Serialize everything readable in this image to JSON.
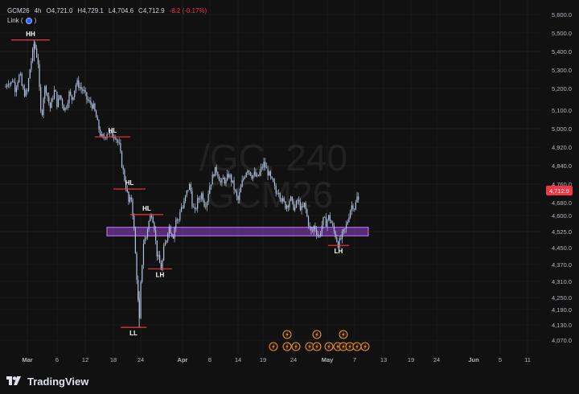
{
  "legend": {
    "symbol": "GCM26",
    "interval": "4h",
    "open_label": "O",
    "open": "4,721.0",
    "high_label": "H",
    "high": "4,729.1",
    "low_label": "L",
    "low": "4,704.6",
    "close_label": "C",
    "close": "4,712.9",
    "change": "-8.2 (-0.17%)",
    "link_label": "Link ("
  },
  "watermark": {
    "line1": "/GC, 240",
    "line2": "GCM26"
  },
  "price_badge": "4,712.9",
  "brand": "TradingView",
  "colors": {
    "background": "#111111",
    "candle": "#b2c3e0",
    "level_line": "#f23645",
    "zone_fill": "#8e44c9",
    "zone_border": "#c77dff",
    "price_badge": "#f23645",
    "axis_text": "#b2b5be",
    "event_icon": "#f08a24"
  },
  "chart_data": {
    "type": "candlestick",
    "symbol": "GCM26",
    "interval": "4h",
    "y_ticks": [
      "5,600.0",
      "5,500.0",
      "5,400.0",
      "5,300.0",
      "5,200.0",
      "5,100.0",
      "5,000.0",
      "4,920.0",
      "4,840.0",
      "4,760.0",
      "4,680.0",
      "4,600.0",
      "4,525.0",
      "4,450.0",
      "4,370.0",
      "4,310.0",
      "4,250.0",
      "4,190.0",
      "4,130.0",
      "4,070.0"
    ],
    "x_ticks": [
      "Mar",
      "6",
      "12",
      "18",
      "24",
      "Apr",
      "8",
      "14",
      "19",
      "24",
      "May",
      "7",
      "13",
      "19",
      "24",
      "Jun",
      "5",
      "11"
    ],
    "ylim": [
      4040,
      5620
    ],
    "last_price": 4712.9,
    "swing_labels": [
      {
        "text": "HH",
        "price": 5480
      },
      {
        "text": "HL",
        "price": 5025
      },
      {
        "text": "HL",
        "price": 4780
      },
      {
        "text": "HL",
        "price": 4660
      },
      {
        "text": "LH",
        "price": 4405
      },
      {
        "text": "LL",
        "price": 4130
      },
      {
        "text": "LH",
        "price": 4515
      }
    ],
    "zone": {
      "from": 4560,
      "to": 4600
    },
    "close_path": [
      [
        0,
        5260
      ],
      [
        3,
        5290
      ],
      [
        6,
        5270
      ],
      [
        9,
        5300
      ],
      [
        12,
        5250
      ],
      [
        15,
        5290
      ],
      [
        18,
        5320
      ],
      [
        21,
        5250
      ],
      [
        24,
        5230
      ],
      [
        27,
        5230
      ],
      [
        30,
        5330
      ],
      [
        33,
        5400
      ],
      [
        36,
        5470
      ],
      [
        38,
        5430
      ],
      [
        41,
        5370
      ],
      [
        43,
        5200
      ],
      [
        45,
        5100
      ],
      [
        47,
        5200
      ],
      [
        50,
        5270
      ],
      [
        53,
        5210
      ],
      [
        56,
        5160
      ],
      [
        59,
        5210
      ],
      [
        62,
        5250
      ],
      [
        65,
        5170
      ],
      [
        68,
        5220
      ],
      [
        71,
        5190
      ],
      [
        74,
        5150
      ],
      [
        77,
        5180
      ],
      [
        80,
        5230
      ],
      [
        83,
        5200
      ],
      [
        86,
        5240
      ],
      [
        89,
        5280
      ],
      [
        92,
        5270
      ],
      [
        95,
        5250
      ],
      [
        98,
        5240
      ],
      [
        101,
        5210
      ],
      [
        104,
        5190
      ],
      [
        107,
        5180
      ],
      [
        110,
        5170
      ],
      [
        113,
        5130
      ],
      [
        116,
        5080
      ],
      [
        119,
        5040
      ],
      [
        122,
        5010
      ],
      [
        125,
        5030
      ],
      [
        128,
        5050
      ],
      [
        131,
        5040
      ],
      [
        134,
        5030
      ],
      [
        137,
        5040
      ],
      [
        140,
        5010
      ],
      [
        143,
        4980
      ],
      [
        146,
        4900
      ],
      [
        149,
        4840
      ],
      [
        152,
        4780
      ],
      [
        155,
        4710
      ],
      [
        158,
        4740
      ],
      [
        161,
        4620
      ],
      [
        164,
        4420
      ],
      [
        166,
        4300
      ],
      [
        168,
        4130
      ],
      [
        170,
        4330
      ],
      [
        172,
        4450
      ],
      [
        174,
        4560
      ],
      [
        176,
        4530
      ],
      [
        178,
        4590
      ],
      [
        181,
        4640
      ],
      [
        184,
        4670
      ],
      [
        187,
        4600
      ],
      [
        190,
        4480
      ],
      [
        193,
        4440
      ],
      [
        196,
        4400
      ],
      [
        199,
        4500
      ],
      [
        202,
        4540
      ],
      [
        205,
        4610
      ],
      [
        208,
        4580
      ],
      [
        211,
        4560
      ],
      [
        214,
        4640
      ],
      [
        217,
        4620
      ],
      [
        220,
        4700
      ],
      [
        223,
        4690
      ],
      [
        226,
        4740
      ],
      [
        229,
        4780
      ],
      [
        232,
        4800
      ],
      [
        235,
        4700
      ],
      [
        238,
        4670
      ],
      [
        241,
        4720
      ],
      [
        244,
        4740
      ],
      [
        247,
        4760
      ],
      [
        250,
        4710
      ],
      [
        253,
        4720
      ],
      [
        256,
        4790
      ],
      [
        259,
        4820
      ],
      [
        262,
        4860
      ],
      [
        265,
        4870
      ],
      [
        268,
        4840
      ],
      [
        271,
        4800
      ],
      [
        274,
        4830
      ],
      [
        277,
        4810
      ],
      [
        280,
        4850
      ],
      [
        283,
        4830
      ],
      [
        286,
        4800
      ],
      [
        289,
        4760
      ],
      [
        292,
        4720
      ],
      [
        295,
        4770
      ],
      [
        298,
        4820
      ],
      [
        301,
        4850
      ],
      [
        304,
        4880
      ],
      [
        307,
        4860
      ],
      [
        310,
        4840
      ],
      [
        313,
        4850
      ],
      [
        316,
        4830
      ],
      [
        319,
        4850
      ],
      [
        322,
        4880
      ],
      [
        325,
        4900
      ],
      [
        328,
        4870
      ],
      [
        331,
        4850
      ],
      [
        334,
        4820
      ],
      [
        337,
        4800
      ],
      [
        340,
        4760
      ],
      [
        343,
        4780
      ],
      [
        346,
        4740
      ],
      [
        349,
        4720
      ],
      [
        352,
        4700
      ],
      [
        355,
        4710
      ],
      [
        358,
        4740
      ],
      [
        361,
        4700
      ],
      [
        364,
        4690
      ],
      [
        367,
        4730
      ],
      [
        370,
        4700
      ],
      [
        373,
        4680
      ],
      [
        376,
        4710
      ],
      [
        379,
        4650
      ],
      [
        382,
        4600
      ],
      [
        385,
        4570
      ],
      [
        388,
        4610
      ],
      [
        391,
        4580
      ],
      [
        394,
        4550
      ],
      [
        397,
        4600
      ],
      [
        400,
        4640
      ],
      [
        403,
        4620
      ],
      [
        406,
        4650
      ],
      [
        409,
        4630
      ],
      [
        412,
        4590
      ],
      [
        415,
        4560
      ],
      [
        418,
        4520
      ],
      [
        421,
        4540
      ],
      [
        424,
        4570
      ],
      [
        427,
        4590
      ],
      [
        430,
        4630
      ],
      [
        433,
        4680
      ],
      [
        436,
        4710
      ],
      [
        439,
        4690
      ],
      [
        442,
        4740
      ],
      [
        445,
        4712.9
      ]
    ]
  }
}
